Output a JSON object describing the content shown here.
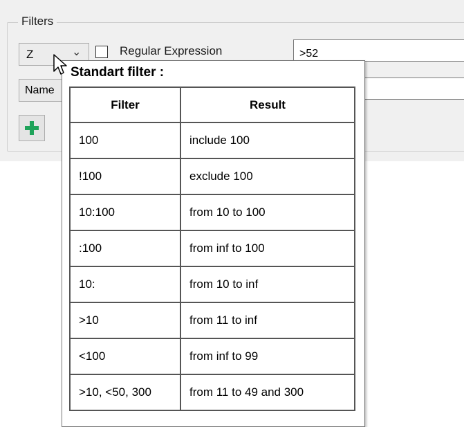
{
  "filters_group": {
    "title": "Filters",
    "column_combo": {
      "value": "Z"
    },
    "regex_checkbox": {
      "label": "Regular Expression",
      "checked": false
    },
    "filter_input": {
      "value": ">52"
    },
    "name_field": {
      "value": "Name"
    },
    "add_button_icon": "plus-icon"
  },
  "tooltip": {
    "title": "Standart filter :",
    "headers": [
      "Filter",
      "Result"
    ],
    "rows": [
      [
        "100",
        "include 100"
      ],
      [
        "!100",
        "exclude 100"
      ],
      [
        "10:100",
        "from 10 to 100"
      ],
      [
        ":100",
        "from inf to 100"
      ],
      [
        "10:",
        "from 10 to inf"
      ],
      [
        ">10",
        "from 11 to inf"
      ],
      [
        "<100",
        "from inf to 99"
      ],
      [
        ">10, <50, 300",
        "from 11 to 49 and 300"
      ]
    ]
  },
  "colors": {
    "accent_plus": "#1fa35a",
    "panel": "#f0f0f0"
  }
}
